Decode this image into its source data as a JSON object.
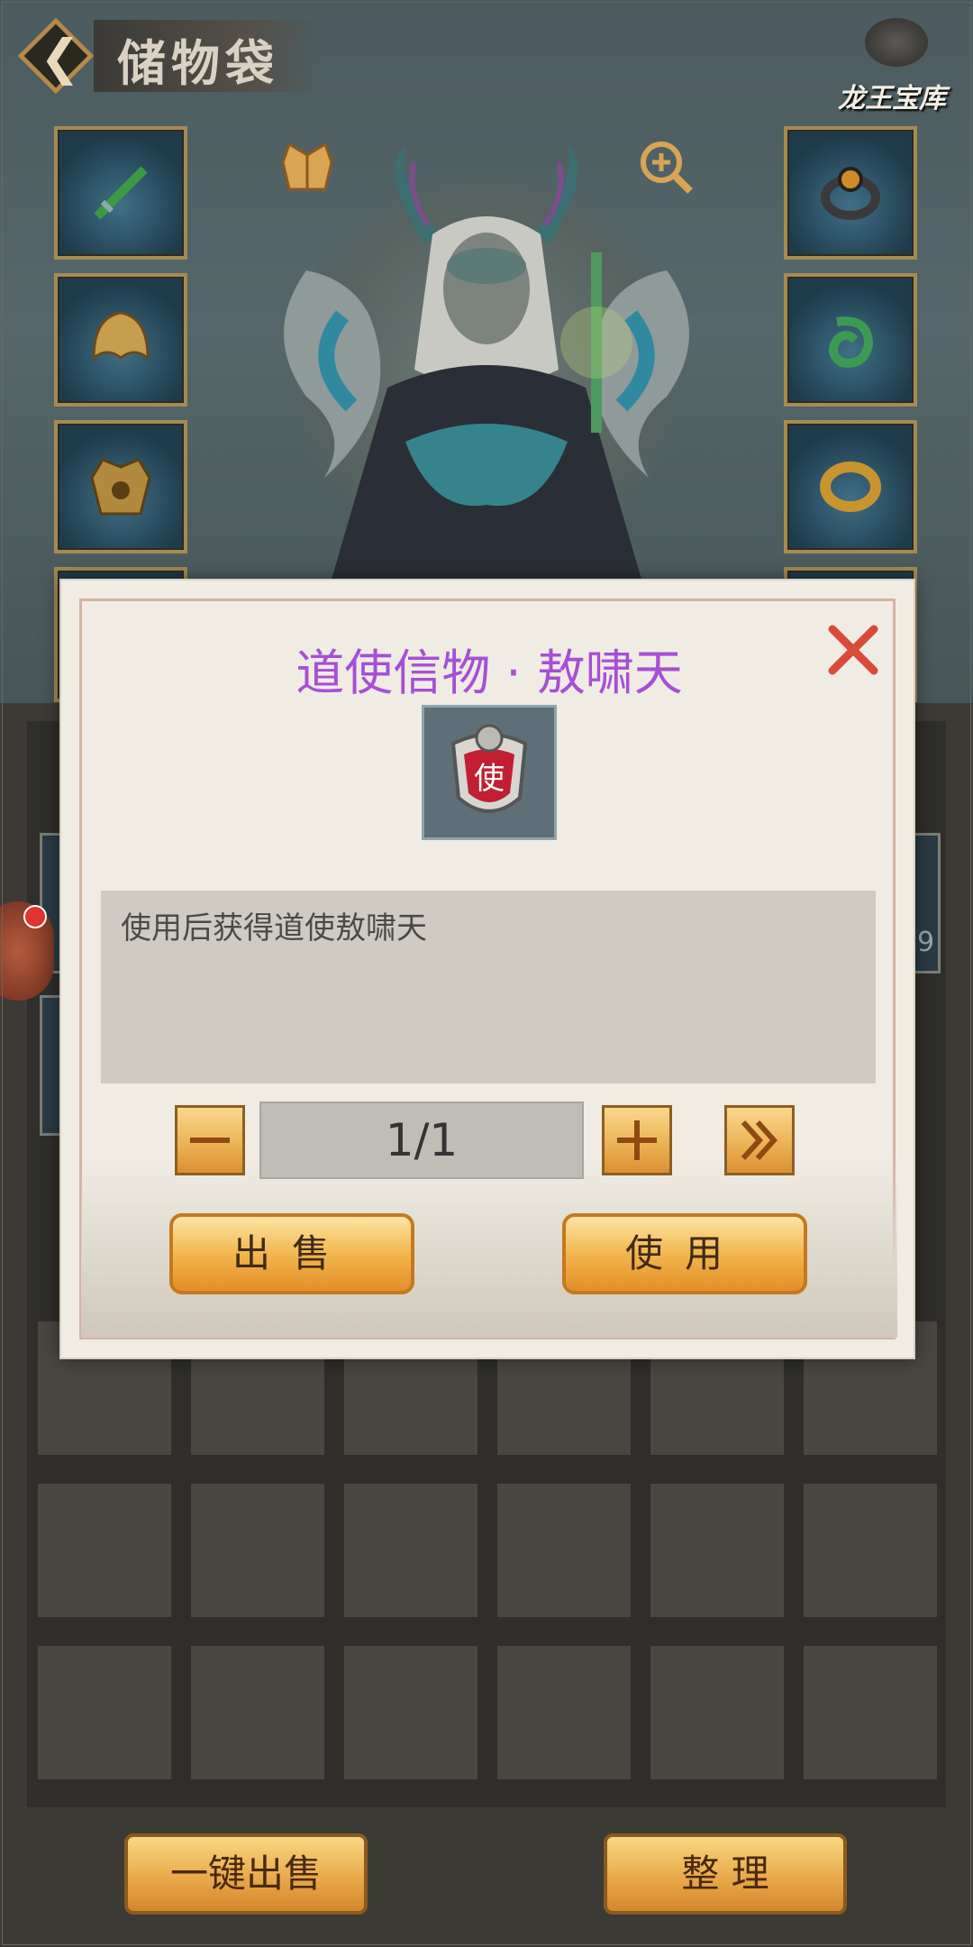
{
  "header": {
    "back_icon": "chevron-left-icon",
    "title": "储物袋",
    "treasure_label": "龙王宝库"
  },
  "equipment": {
    "left_slots": [
      "sword",
      "helmet",
      "armor"
    ],
    "right_slots": [
      "ring-dark",
      "jade-pendant",
      "gold-ring"
    ],
    "top_icons": [
      "fashion-icon",
      "zoom-in-icon"
    ]
  },
  "dialog": {
    "title": "道使信物 · 敖啸天",
    "title_color": "#a64fd6",
    "item_glyph": "使",
    "description": "使用后获得道使敖啸天",
    "quantity": "1/1",
    "minus_icon": "minus-icon",
    "plus_icon": "plus-icon",
    "max_icon": "double-chevron-right-icon",
    "close_icon": "close-icon",
    "sell_label": "出售",
    "use_label": "使用"
  },
  "bottom": {
    "sell_all_label": "一键出售",
    "sort_label": "整 理"
  },
  "edge_number": "9"
}
